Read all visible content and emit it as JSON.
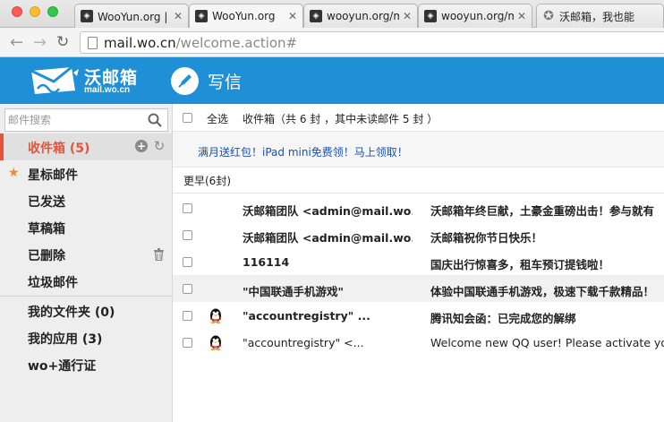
{
  "browser": {
    "tabs": [
      {
        "title": "WooYun.org | 自"
      },
      {
        "title": "WooYun.org"
      },
      {
        "title": "wooyun.org/m"
      },
      {
        "title": "wooyun.org/m"
      },
      {
        "title": "沃邮箱，我也能"
      }
    ],
    "url_host": "mail.wo.cn",
    "url_path": "/welcome.action#"
  },
  "header": {
    "logo_name": "沃邮箱",
    "logo_domain": "mail.wo.cn",
    "compose_label": "写信",
    "color": "#1f8fd6"
  },
  "sidebar": {
    "search_placeholder": "邮件搜索",
    "folders": [
      {
        "label": "收件箱 (5)"
      },
      {
        "label": "星标邮件"
      },
      {
        "label": "已发送"
      },
      {
        "label": "草稿箱"
      },
      {
        "label": "已删除"
      },
      {
        "label": "垃圾邮件"
      },
      {
        "label": "我的文件夹 (0)"
      },
      {
        "label": "我的应用 (3)"
      },
      {
        "label": "wo+通行证"
      }
    ]
  },
  "list": {
    "select_all": "全选",
    "folder_info": "收件箱（共 6 封 ，其中未读邮件 5 封 ）",
    "promo": "满月送红包！iPad mini免费领！马上领取！",
    "group_label": "更早(6封)",
    "rows": [
      {
        "sender": "沃邮箱团队 <admin@mail.wo.cn>",
        "subject": "沃邮箱年终巨献，土豪金重磅出击！参与就有",
        "unread": true,
        "qq": false
      },
      {
        "sender": "沃邮箱团队 <admin@mail.wo.cn>",
        "subject": "沃邮箱祝你节日快乐！",
        "unread": true,
        "qq": false
      },
      {
        "sender": "116114",
        "subject": "国庆出行惊喜多，租车预订提钱啦！",
        "unread": true,
        "qq": false
      },
      {
        "sender": "\"中国联通手机游戏\"",
        "subject": "体验中国联通手机游戏，极速下载千款精品！",
        "unread": true,
        "qq": false
      },
      {
        "sender": "\"accountregistry\" ...",
        "subject": "腾讯知会函：已完成您的解绑",
        "unread": true,
        "qq": true
      },
      {
        "sender": "\"accountregistry\" <...",
        "subject": "Welcome new QQ user! Please activate yo",
        "unread": false,
        "qq": true
      }
    ]
  }
}
